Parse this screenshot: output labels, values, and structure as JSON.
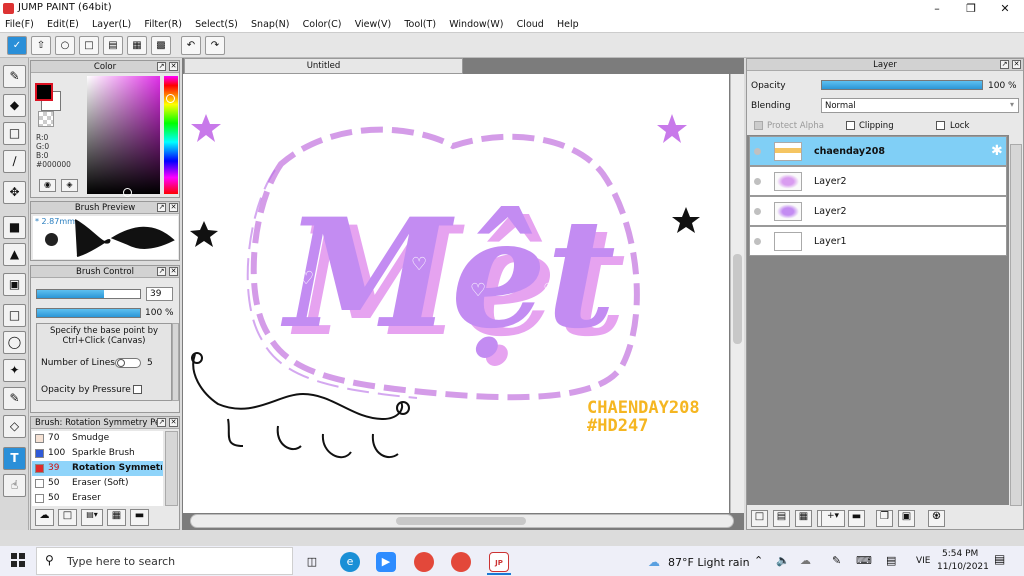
{
  "app": {
    "title": "JUMP PAINT (64bit)"
  },
  "menu": [
    "File(F)",
    "Edit(E)",
    "Layer(L)",
    "Filter(R)",
    "Select(S)",
    "Snap(N)",
    "Color(C)",
    "View(V)",
    "Tool(T)",
    "Window(W)",
    "Cloud",
    "Help"
  ],
  "color_panel": {
    "title": "Color",
    "r": "R:0",
    "g": "G:0",
    "b": "B:0",
    "hex": "#000000",
    "fg": "#000000",
    "bg": "#ffffff"
  },
  "brush_preview": {
    "title": "Brush Preview",
    "size": "* 2.87mm"
  },
  "brush_control": {
    "title": "Brush Control",
    "size_value": "39",
    "size_ratio": 0.65,
    "opacity_value": "100 %",
    "opacity_ratio": 1.0,
    "hint": "Specify the base point by Ctrl+Click (Canvas)",
    "lines_label": "Number of Lines",
    "lines_value": "5",
    "pressure_label": "Opacity by Pressure"
  },
  "brush_list": {
    "title": "Brush: Rotation Symmetry Pen",
    "items": [
      {
        "size": "70",
        "name": "Smudge",
        "color": "#f6e2d4"
      },
      {
        "size": "100",
        "name": "Sparkle Brush",
        "color": "#2f5ad8"
      },
      {
        "size": "39",
        "name": "Rotation Symmetry",
        "color": "#e02a2a"
      },
      {
        "size": "50",
        "name": "Eraser (Soft)",
        "color": "#ffffff"
      },
      {
        "size": "50",
        "name": "Eraser",
        "color": "#ffffff"
      }
    ]
  },
  "canvas": {
    "tab": "Untitled",
    "title_text": "Mệt",
    "signature_1": "CHAENDAY208",
    "signature_2": "#HD247",
    "colors": {
      "purple": "#c38cf2",
      "pink": "#e87bdd",
      "outline": "#d49ce8",
      "yellow": "#f5b622"
    }
  },
  "layer_panel": {
    "title": "Layer",
    "opacity_label": "Opacity",
    "opacity_value": "100 %",
    "opacity_ratio": 1.0,
    "blending_label": "Blending",
    "blending_value": "Normal",
    "protect_alpha": "Protect Alpha",
    "clipping": "Clipping",
    "lock": "Lock",
    "layers": [
      {
        "name": "chaenday208",
        "selected": true
      },
      {
        "name": "Layer2",
        "selected": false
      },
      {
        "name": "Layer2",
        "selected": false
      },
      {
        "name": "Layer1",
        "selected": false
      }
    ]
  },
  "taskbar": {
    "search_placeholder": "Type here to search",
    "weather": "87°F  Light rain",
    "lang": "VIE",
    "time": "5:54 PM",
    "date": "11/10/2021"
  }
}
